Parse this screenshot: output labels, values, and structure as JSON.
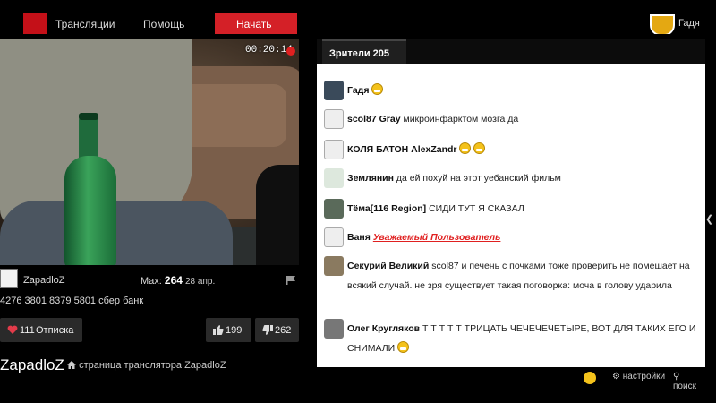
{
  "topbar": {
    "nav_broadcasts": "Трансляции",
    "nav_help": "Помощь",
    "start_button": "Начать",
    "user_short": "Гадя"
  },
  "video": {
    "timer": "00:20:14"
  },
  "streamer": {
    "name": "ZapadloZ",
    "max_label": "Max:",
    "max_value": "264",
    "max_date": "28 апр.",
    "description": "4276 3801 8379 5801 сбер банк"
  },
  "actions": {
    "unsubscribe_count": "111",
    "unsubscribe_label": "Отписка",
    "likes": "199",
    "dislikes": "262"
  },
  "page": {
    "streamer_title": "ZapadloZ",
    "link_text": "страница транслятора ZapadloZ"
  },
  "chat": {
    "tab_label": "Зрители 205",
    "messages": [
      {
        "nick": "Гадя",
        "text": "",
        "emoji": 1
      },
      {
        "nick": "scol87 Gray",
        "text": "микроинфарктом мозга да",
        "emoji": 0
      },
      {
        "nick": "КОЛЯ БАТОН AlexZandr",
        "text": "",
        "emoji": 2
      },
      {
        "nick": "Землянин",
        "text": "да ей похуй на этот уебанский фильм",
        "emoji": 0
      },
      {
        "nick": "Тёма[116 Region]",
        "text": "СИДИ ТУТ Я СКАЗАЛ",
        "emoji": 0
      },
      {
        "nick": "Ваня",
        "text": "Уважаемый Пользователь",
        "emoji": 0
      },
      {
        "nick": "Секурий Великий",
        "text": "scol87 и печень с почками тоже проверить не помешает на всякий случай. не зря существует такая поговорка: моча в голову ударила",
        "emoji": 0
      },
      {
        "nick": "Олег Кругляков",
        "text": "Т Т Т Т Т ТРИЦАТЬ ЧЕЧЕЧЕЧЕТЫРЕ, ВОТ ДЛЯ ТАКИХ ЕГО И СНИМАЛИ",
        "emoji": 1
      }
    ],
    "footer_settings": "настройки",
    "footer_search": "поиск"
  },
  "colors": {
    "accent_red": "#d42027",
    "chat_bg": "#ffffff",
    "page_bg": "#000000"
  }
}
